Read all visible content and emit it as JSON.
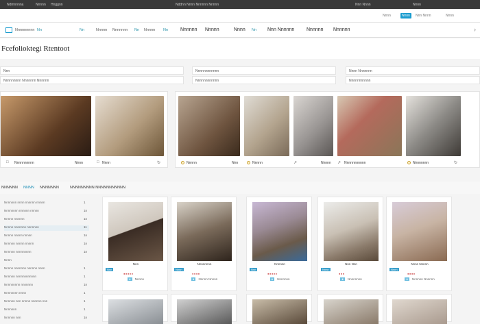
{
  "topbar": {
    "items": [
      "Ndmnnnna",
      "Nnnnn",
      "Hnggnn",
      "Nddnn Nnnn Nnnnnn Nnnnn"
    ],
    "right_items": [
      "Nnn Nnnn",
      "Nnnn"
    ]
  },
  "subbar": {
    "right": [
      "Nnnn",
      "Nnnn",
      "Nnn Nnnn",
      "Nnnn"
    ]
  },
  "nav": {
    "brand": "Nnnnnnnnn",
    "brand_badge": "Nn",
    "items": [
      "Nn",
      "Nnnnn",
      "Nnnnnnn",
      "Nn",
      "Nnnnn",
      "Nn",
      "Nnnnnn",
      "Nnnnn",
      "Nnnn",
      "Nnnnn",
      "Nn",
      "Nnn Nnnnnn",
      "Nnnnnn",
      "Nnnnnn"
    ]
  },
  "page": {
    "title": "Fcefolioktegi Rtentoot"
  },
  "filters": [
    {
      "label": "Nnn",
      "value": "Nnnnnnnnn Nnnnnnn  Nnnnnn"
    },
    {
      "label": "Nnnnnnnnnnnn",
      "value": "Nnnnnnnnnnnn"
    },
    {
      "label": "Nnnn Nnnnnnn",
      "value": "Nnnnnnnnnnn"
    }
  ],
  "featured_left": [
    {
      "caption": "Nnnnnnnnnn",
      "price": "Nnnn",
      "swatch": "#6e4a2e"
    },
    {
      "caption": "Nnnn",
      "price": "",
      "swatch": "#b7a58a"
    }
  ],
  "featured_right": [
    {
      "caption": "Nnnnn",
      "price": "Nnn",
      "swatch": "#8a7a6a"
    },
    {
      "caption": "Nnnnn",
      "price": "",
      "swatch": "#b9b4ad"
    },
    {
      "caption": "Nnnnn",
      "price": "",
      "swatch": "#9c9898"
    },
    {
      "caption": "Nnnnnnnnnnn",
      "price": "",
      "swatch": "#b46a5c"
    },
    {
      "caption": "Nnnnnnnn",
      "price": "",
      "swatch": "#6e6f6b"
    }
  ],
  "tabs": [
    "NNNNNN",
    "NNNN",
    "NNNNNNN",
    "NNNNNNNNN  NNNNNNNNNNN"
  ],
  "sidebar": [
    {
      "label": "Nnnnnnn nnnn nnnnnn nnnnn",
      "count": "1"
    },
    {
      "label": "Nnnnnnnn nnnnnn nnnnn",
      "count": "1n"
    },
    {
      "label": "Nnnnn nnnnnn",
      "count": "1n"
    },
    {
      "label": "Nnnnn nnnnnnn nnnnnnn",
      "count": "11"
    },
    {
      "label": "Nnnnn nnnnn nnnnn",
      "count": "1n"
    },
    {
      "label": "Nnnnnn nnnnn nnnnn",
      "count": "1n"
    },
    {
      "label": "Nnnnnn nnnnnnnnn",
      "count": "1n"
    },
    {
      "label": "Nnnn",
      "count": ""
    },
    {
      "label": "Nnnnn nnnnnnn nnnnnn nnnn",
      "count": "1"
    },
    {
      "label": "Nnnnnn nnnnnnnnnnnn",
      "count": "1"
    },
    {
      "label": "Nnnnnnnnn nnnnnnn",
      "count": "1n"
    },
    {
      "label": "Nnnnnnnn nnnn",
      "count": "1"
    },
    {
      "label": "Nnnnnn nnn nnnnn nnnnnn nnn",
      "count": "1"
    },
    {
      "label": "Nnnnnnn",
      "count": "1"
    },
    {
      "label": "Nnnnnn nnn",
      "count": "1n"
    }
  ],
  "products": [
    {
      "name": "Nnn",
      "tag": "Nnn",
      "stars": "●●●●●",
      "meta": "Nnnnn",
      "color": "#3a2c24"
    },
    {
      "name": "Nnnnnnnn",
      "tag": "Nnnn",
      "stars": "●●●●",
      "meta": "Nnnnn Nnnnn",
      "color": "#5a4a3a"
    },
    {
      "name": "Nnnnnn",
      "tag": "Nnn",
      "stars": "●●●●●",
      "meta": "Nnnnnnn",
      "color": "#7a6a8a"
    },
    {
      "name": "Nnn Nnn",
      "tag": "Nnnn",
      "stars": "●●●",
      "meta": "Nnnnnnnn",
      "color": "#8a7a6a"
    },
    {
      "name": "Nnnn Nnnnn",
      "tag": "Nnnn",
      "stars": "●●●●",
      "meta": "Nnnnnn Nnnnnn",
      "color": "#b8a090"
    }
  ],
  "products_row2": [
    {
      "color": "#8a8f94"
    },
    {
      "color": "#6a6a6a"
    },
    {
      "color": "#5a4a3a"
    },
    {
      "color": "#8a7a6a"
    },
    {
      "color": "#a99a8e"
    }
  ]
}
